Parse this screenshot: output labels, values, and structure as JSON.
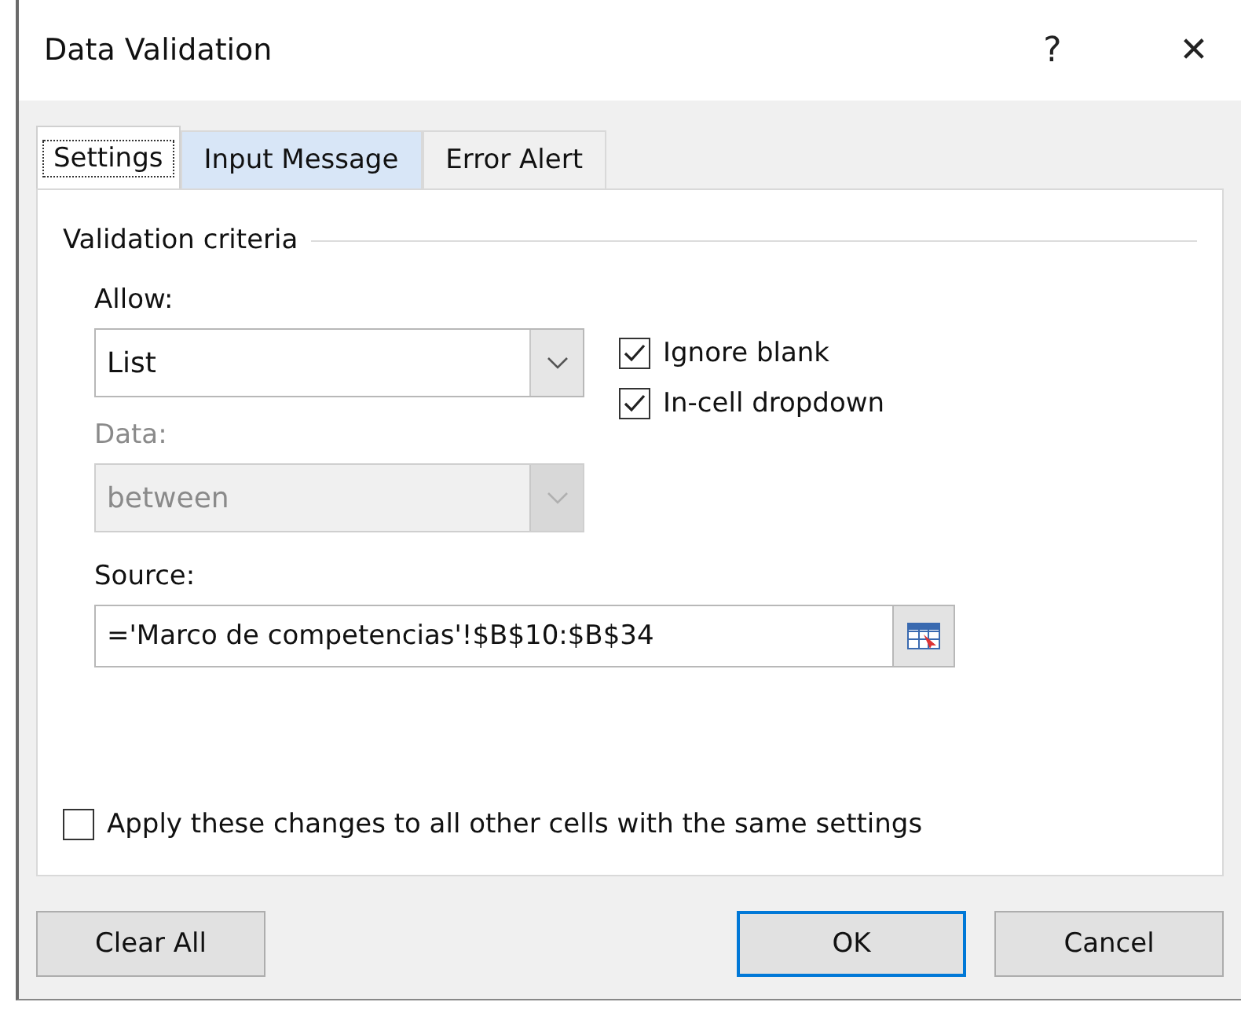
{
  "window": {
    "title": "Data Validation",
    "help": "?",
    "close": "✕"
  },
  "tabs": [
    {
      "label": "Settings",
      "selected": true
    },
    {
      "label": "Input Message",
      "selected": false
    },
    {
      "label": "Error Alert",
      "selected": false
    }
  ],
  "group": {
    "title": "Validation criteria"
  },
  "allow": {
    "label": "Allow:",
    "value": "List",
    "disabled": false
  },
  "data": {
    "label": "Data:",
    "value": "between",
    "disabled": true
  },
  "options": [
    {
      "label": "Ignore blank",
      "checked": true
    },
    {
      "label": "In-cell dropdown",
      "checked": true
    }
  ],
  "source": {
    "label": "Source:",
    "value": "='Marco de competencias'!$B$10:$B$34"
  },
  "apply_all": {
    "label": "Apply these changes to all other cells with the same settings",
    "checked": false
  },
  "buttons": [
    {
      "label": "Clear All",
      "default": false
    },
    {
      "label": "OK",
      "default": true
    },
    {
      "label": "Cancel",
      "default": false
    }
  ]
}
